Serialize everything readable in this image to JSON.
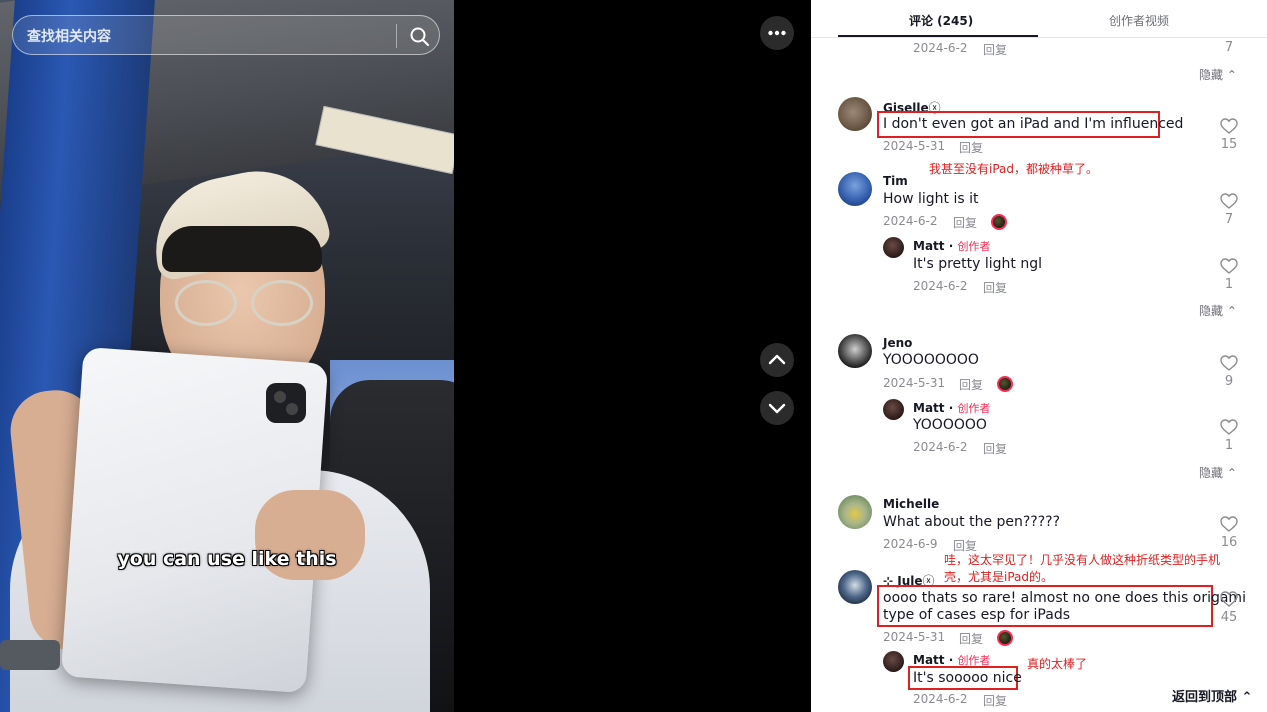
{
  "search": {
    "placeholder": "查找相关内容"
  },
  "video": {
    "caption": "you can use like this"
  },
  "tabs": {
    "comments": "评论 (245)",
    "creator_videos": "创作者视频"
  },
  "reply_label": "回复",
  "hide_label": "隐藏",
  "creator_tag": "创作者",
  "top_fragment": {
    "date": "2024-6-2",
    "likes": "7"
  },
  "comments": [
    {
      "user": "Giselle",
      "tag": "ⓧ",
      "text": "I don't even got an iPad and I'm influenced",
      "date": "2024-5-31",
      "likes": "15"
    },
    {
      "user": "Tim",
      "text": "How light is it",
      "date": "2024-6-2",
      "likes": "7",
      "reply": {
        "user": "Matt",
        "text": "It's pretty light ngl",
        "date": "2024-6-2",
        "likes": "1"
      }
    },
    {
      "user": "Jeno",
      "text": "YOOOOOOOO",
      "date": "2024-5-31",
      "likes": "9",
      "reply": {
        "user": "Matt",
        "text": "YOOOOOO",
        "date": "2024-6-2",
        "likes": "1"
      }
    },
    {
      "user": "Michelle",
      "text": "What about the pen?????",
      "date": "2024-6-9",
      "likes": "16"
    },
    {
      "user": "Jule",
      "prefix": "⊹",
      "tag": "ⓧ",
      "text_line1": "oooo thats so rare! almost no one does this origami",
      "text_line2": "type of cases esp for iPads",
      "date": "2024-5-31",
      "likes": "45",
      "reply": {
        "user": "Matt",
        "text": "It's sooooo nice",
        "date": "2024-6-2"
      }
    }
  ],
  "annotations": {
    "giselle": "我甚至没有iPad，都被种草了。",
    "jule_line1": "哇，这太罕见了！几乎没有人做这种折纸类型的手机",
    "jule_line2": "壳，尤其是iPad的。",
    "matt": "真的太棒了"
  },
  "back_to_top": "返回到顶部",
  "colors": {
    "accent": "#fe2c55",
    "annotation": "#e02020"
  }
}
